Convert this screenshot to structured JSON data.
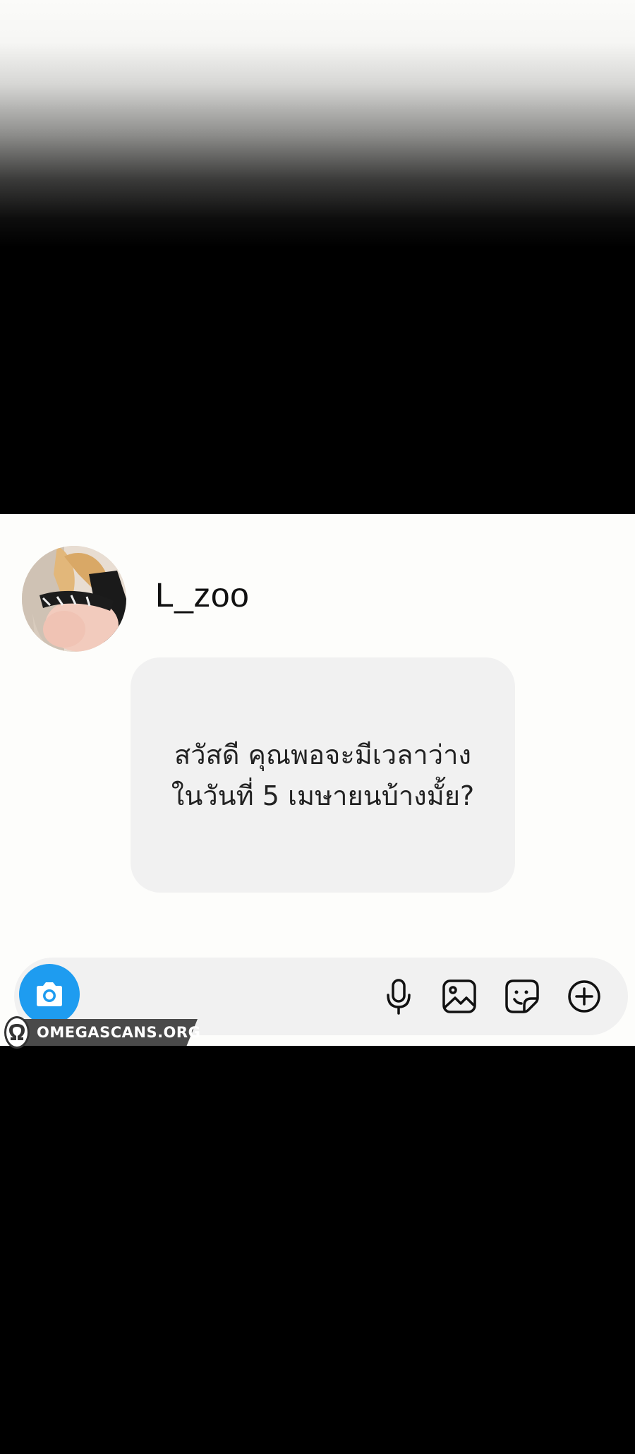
{
  "contact": {
    "username": "L_zoo"
  },
  "message": {
    "line1": "สวัสดี คุณพอจะมีเวลาว่าง",
    "line2": "ในวันที่ 5 เมษายนบ้างมั้ย?"
  },
  "input_bar": {
    "icons": [
      "camera-icon",
      "microphone-icon",
      "gallery-icon",
      "sticker-icon",
      "add-icon"
    ],
    "accent": "#1e9cf0"
  },
  "watermark": {
    "text": "OMEGASCANS.ORG"
  }
}
